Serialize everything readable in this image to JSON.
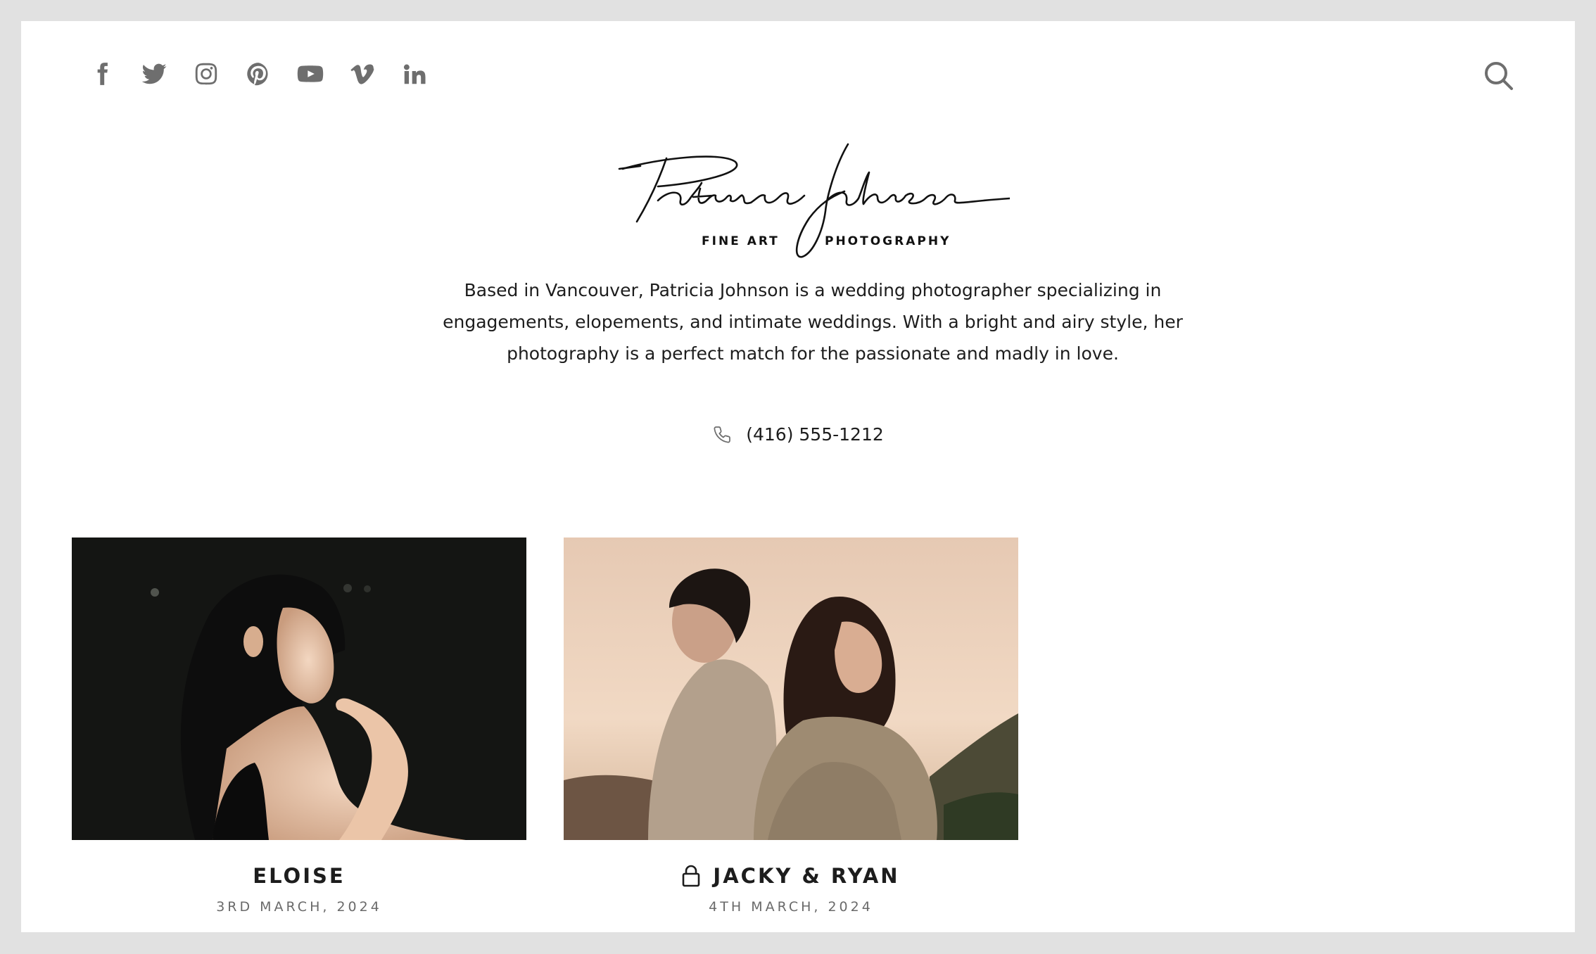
{
  "social": {
    "icons": [
      "facebook-icon",
      "twitter-icon",
      "instagram-icon",
      "pinterest-icon",
      "youtube-icon",
      "vimeo-icon",
      "linkedin-icon"
    ]
  },
  "header": {
    "search_icon": "search-icon",
    "logo_script": "Patricia Johnson",
    "logo_sub_left": "FINE ART",
    "logo_sub_right": "PHOTOGRAPHY"
  },
  "intro": {
    "text": "Based in Vancouver, Patricia Johnson is a wedding photographer specializing in engagements, elopements, and intimate weddings. With a bright and airy style, her photography is a perfect match for the passionate and madly in love.",
    "phone": "(416) 555-1212",
    "phone_icon": "phone-icon"
  },
  "galleries": [
    {
      "title": "ELOISE",
      "date": "3RD MARCH, 2024",
      "locked": false
    },
    {
      "title": "JACKY & RYAN",
      "date": "4TH MARCH, 2024",
      "locked": true,
      "lock_icon": "lock-icon"
    }
  ],
  "colors": {
    "background": "#e1e1e1",
    "page": "#ffffff",
    "icon": "#6e6e6e",
    "text": "#1d1d1d",
    "muted": "#6a6a6a"
  }
}
